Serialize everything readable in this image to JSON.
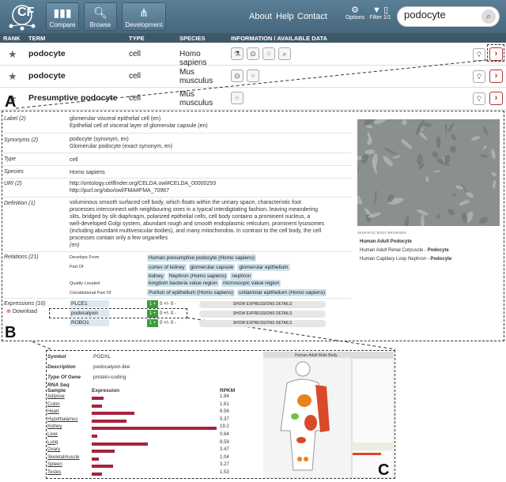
{
  "header": {
    "logo_text": "CF",
    "buttons": [
      {
        "label": "Compare",
        "icon": "bar-chart-icon"
      },
      {
        "label": "Browse",
        "icon": "magnifier-icon"
      },
      {
        "label": "Development",
        "icon": "tree-icon"
      }
    ],
    "links": [
      "About",
      "Help",
      "Contact"
    ],
    "options_label": "Options",
    "filter_label": "Filter 1/1",
    "search_value": "podocyte"
  },
  "columns": {
    "rank": "RANK",
    "term": "TERM",
    "type": "TYPE",
    "species": "SPECIES",
    "info": "INFORMATION / AVAILABLE DATA"
  },
  "results": [
    {
      "term": "podocyte",
      "type": "cell",
      "species": "Homo sapiens"
    },
    {
      "term": "podocyte",
      "type": "cell",
      "species": "Mus musculus"
    },
    {
      "term": "Presumptive podocyte",
      "type": "cell",
      "species": "Mus musculus"
    }
  ],
  "panel_labels": {
    "a": "A",
    "b": "B",
    "c": "C"
  },
  "detail": {
    "label_field": "Label (2)",
    "label_values": [
      "glomerular visceral epithelial cell (en)",
      "Epithelial cell of visceral layer of glomerular capsule (en)"
    ],
    "synonyms_field": "Synonyms (2)",
    "synonyms_values": [
      "podocyte (synonym, en)",
      "Glomerular podocyte (exact synonym, en)"
    ],
    "type_field": "Type",
    "type_value": "cell",
    "species_field": "Species",
    "species_value": "Homo sapiens",
    "uri_field": "URI (2)",
    "uri_values": [
      "http://ontology.cellfinder.org/CELDA.owl#CELDA_00000293",
      "http://purl.org/obo/owl/FMA#FMA_70967"
    ],
    "definition_field": "Definition (1)",
    "definition_lines": [
      "voluminous smooth surfaced cell body, which floats within the urinary space, characteristic foot",
      "processes interconnect with neighbouring ones in a typical interdigitating fashion, leaving meandering",
      "slits, bridged by slit diaphragm, polarized epithelial cells, cell body contains a prominent nucleus, a",
      "well-developed Golgi system, abundant rough and smooth endoplasmic reticulum, prominent lysosomes",
      "(including abundant multivesicular bodies), and many mitochondria. In contrast to the cell body, the cell",
      "processes contain only a few organelles",
      "(en)"
    ],
    "relations_field": "Relations (21)",
    "relations": [
      {
        "name": "Develops From",
        "tags": [
          "Human presumptive podocyte (Homo sapiens)"
        ]
      },
      {
        "name": "Part Of",
        "tags": [
          "cortex of kidney",
          "glomerular capsule",
          "glomerular epithelium",
          "kidney",
          "Nephron (Homo sapiens)",
          "nephron"
        ]
      },
      {
        "name": "Quality Located",
        "tags": [
          "kingdom bacteria value region",
          "microscopic value region"
        ]
      },
      {
        "name": "Constitutional Part Of",
        "tags": [
          "Portion of epithelium (Homo sapiens)",
          "unilaminar epithelium (Homo sapiens)"
        ]
      }
    ],
    "expressions_field": "Expressions (16)",
    "download_label": "Download",
    "expressions": [
      {
        "gene": "PLCE1",
        "plus": "1 +",
        "ctrl": "0 +/- 0 -",
        "show": "SHOW EXPRESSIONS DETAILS"
      },
      {
        "gene": "podocalyxin",
        "plus": "1 +",
        "ctrl": "0 +/- 0 -",
        "show": "SHOW EXPRESSIONS DETAILS"
      },
      {
        "gene": "ROBO1",
        "plus": "1 +",
        "ctrl": "0 +/- 0 -",
        "show": "SHOW EXPRESSIONS DETAILS"
      }
    ],
    "sidebar_title": "SEMANTIC BODY BROWSER",
    "sidebar_items": [
      {
        "text": "Human Adult Podocyte",
        "bold": ""
      },
      {
        "text": "Human Adult Renal Corpuscle - ",
        "bold": "Podocyte"
      },
      {
        "text": "Human Capillary Loop Nephron - ",
        "bold": "Podocyte"
      }
    ]
  },
  "gene_detail": {
    "symbol_field": "Symbol",
    "symbol_value": "PODXL",
    "description_field": "Description",
    "description_value": "podocalyxin-like",
    "type_field": "Type Of Gene",
    "type_value": "protein-coding",
    "rnaseq_label": "RNA Seq",
    "col_sample": "Sample",
    "col_expression": "Expression",
    "col_rpkm": "RPKM",
    "body_title": "Human Adult Male Body"
  },
  "chart_data": {
    "type": "bar",
    "categories": [
      "Adipose",
      "Colon",
      "Heart",
      "Hypothalamus",
      "Kidney",
      "Liver",
      "Lung",
      "Ovary",
      "Skeletalmuscle",
      "Spleen",
      "Testes"
    ],
    "values": [
      1.84,
      1.61,
      6.56,
      5.37,
      19.2,
      0.84,
      8.59,
      3.47,
      1.04,
      3.27,
      1.53
    ],
    "value_labels": [
      "1.84",
      "1.61",
      "6.56",
      "5.37",
      "19.2",
      "0.84",
      "8.59",
      "3.47",
      "1.04",
      "3.27",
      "1.53"
    ],
    "xlabel": "Expression",
    "ylabel": "RPKM",
    "color": "#a7233b"
  }
}
